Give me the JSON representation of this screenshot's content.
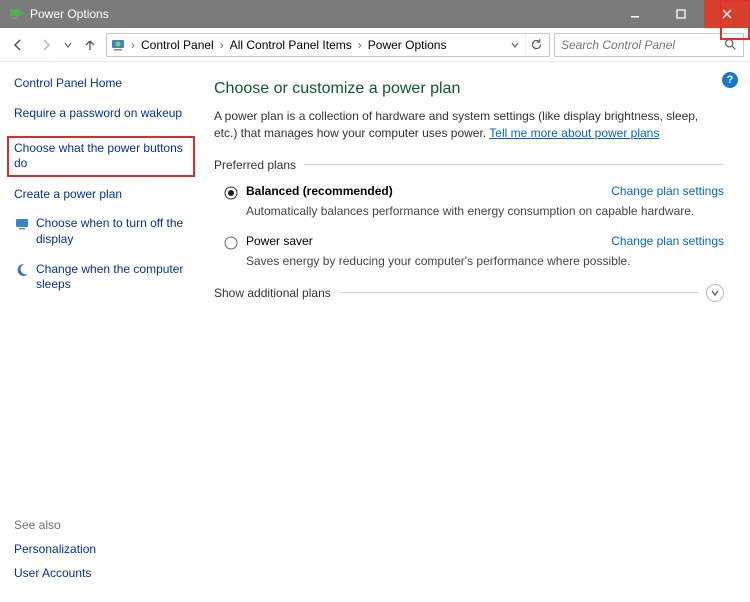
{
  "window": {
    "title": "Power Options"
  },
  "breadcrumbs": {
    "items": [
      "Control Panel",
      "All Control Panel Items",
      "Power Options"
    ]
  },
  "search": {
    "placeholder": "Search Control Panel"
  },
  "left": {
    "home": "Control Panel Home",
    "tasks": [
      {
        "label": "Require a password on wakeup"
      },
      {
        "label": "Choose what the power buttons do",
        "highlight": true
      },
      {
        "label": "Create a power plan"
      },
      {
        "label": "Choose when to turn off the display",
        "icon": "display"
      },
      {
        "label": "Change when the computer sleeps",
        "icon": "moon"
      }
    ],
    "see_also_hdr": "See also",
    "see_also": [
      "Personalization",
      "User Accounts"
    ]
  },
  "main": {
    "heading": "Choose or customize a power plan",
    "intro_a": "A power plan is a collection of hardware and system settings (like display brightness, sleep, etc.) that manages how your computer uses power. ",
    "intro_link": "Tell me more about power plans",
    "preferred_label": "Preferred plans",
    "plans": [
      {
        "name": "Balanced (recommended)",
        "desc": "Automatically balances performance with energy consumption on capable hardware.",
        "selected": true,
        "change": "Change plan settings"
      },
      {
        "name": "Power saver",
        "desc": "Saves energy by reducing your computer's performance where possible.",
        "selected": false,
        "change": "Change plan settings"
      }
    ],
    "show_more": "Show additional plans"
  }
}
